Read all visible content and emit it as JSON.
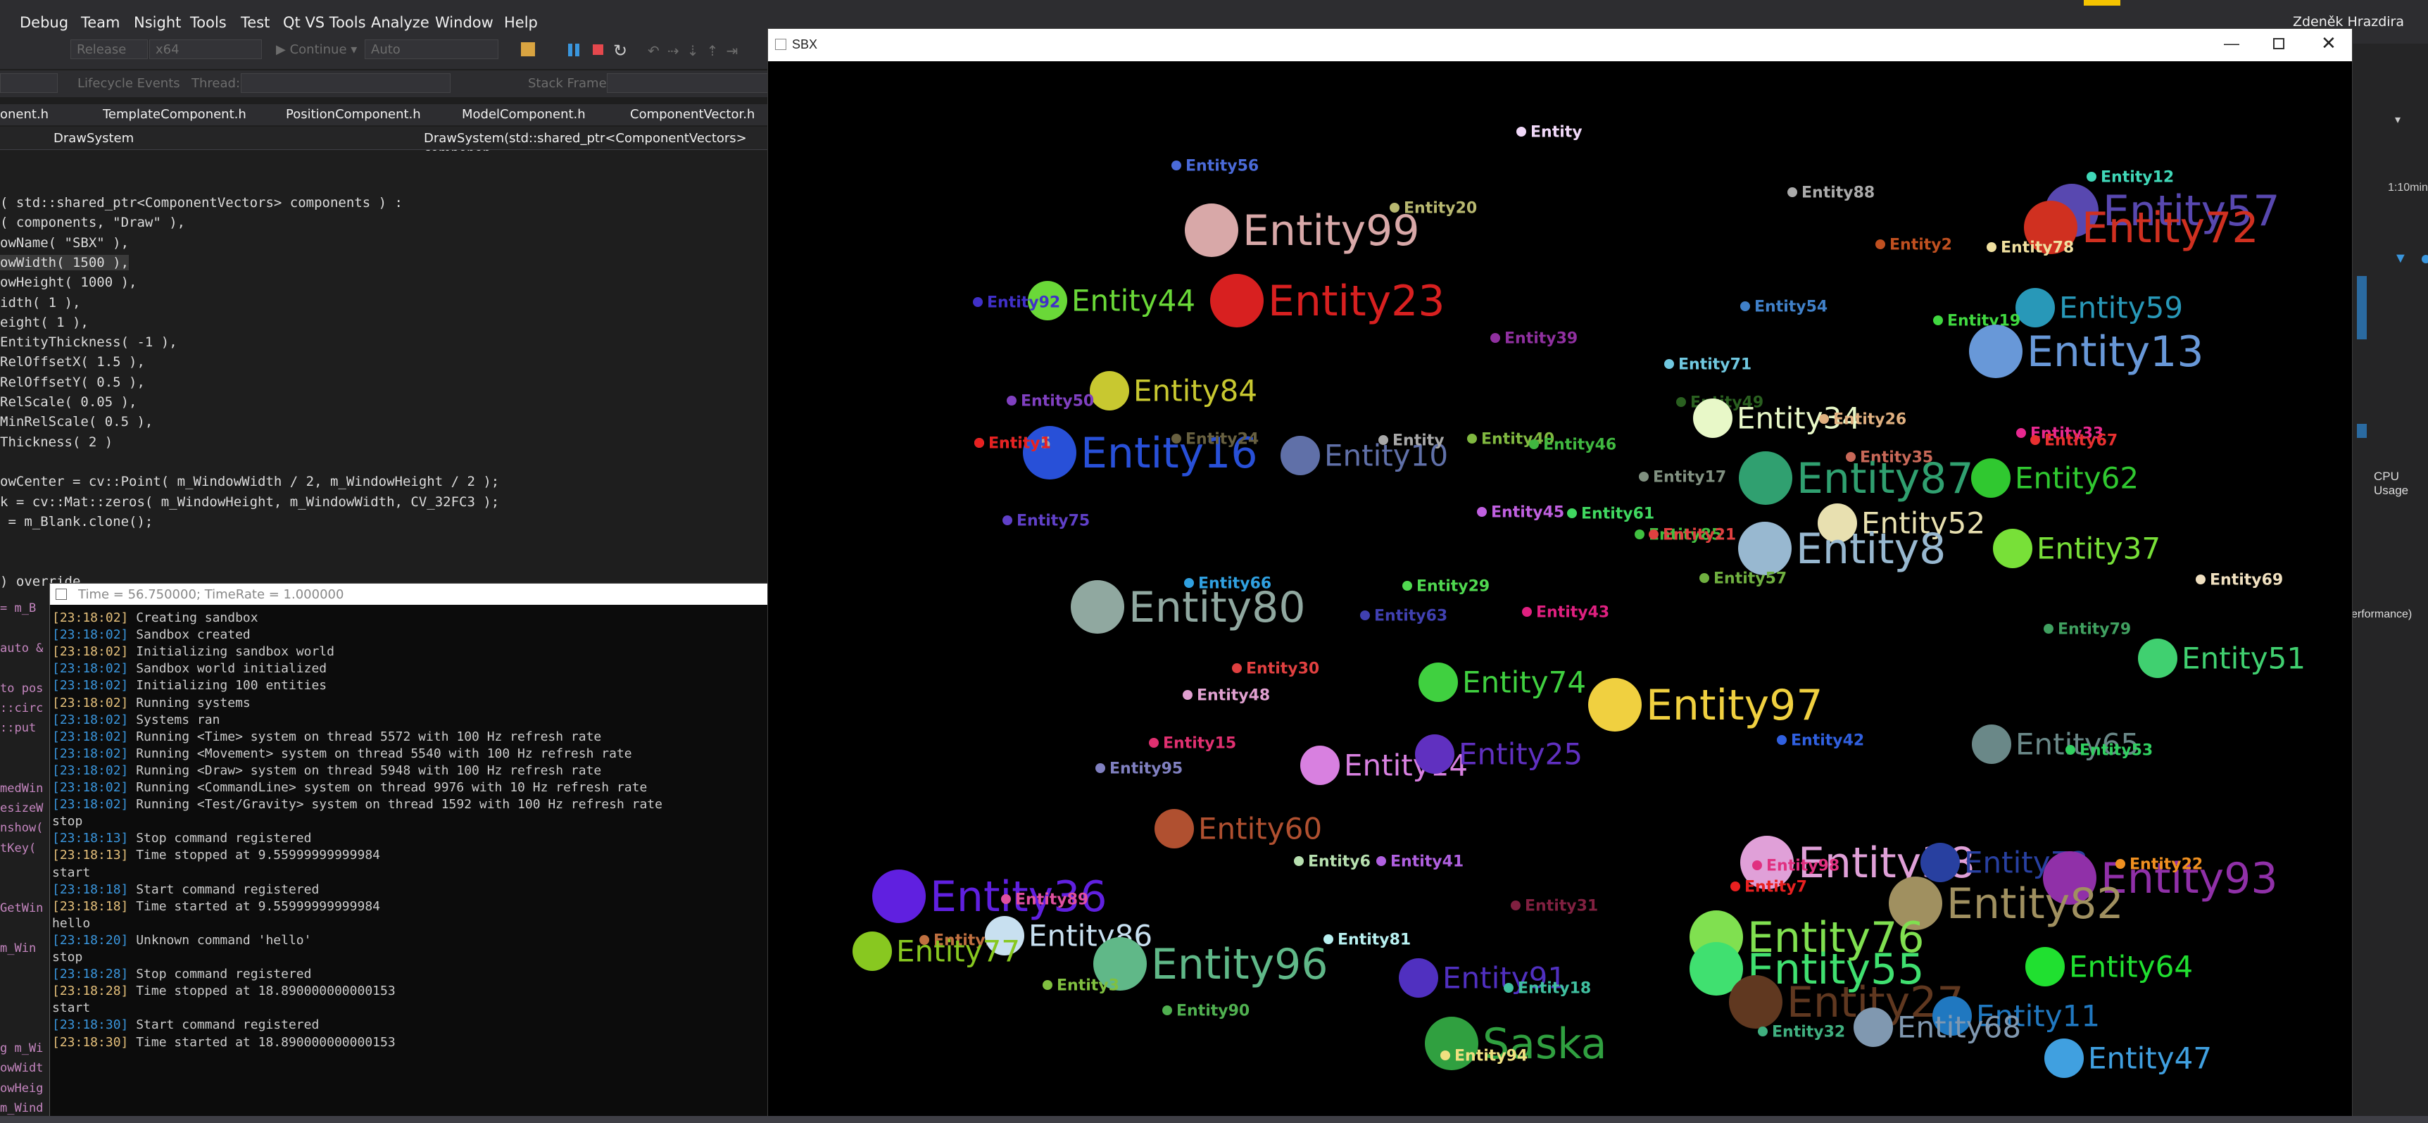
{
  "ide": {
    "menu": [
      "Debug",
      "Team",
      "Nsight",
      "Tools",
      "Test",
      "Qt VS Tools",
      "Analyze",
      "Window",
      "Help"
    ],
    "user": "Zdeněk Hrazdira",
    "toolbar": {
      "config": "Release",
      "platform": "x64",
      "continue_label": "Continue",
      "auto_label": "Auto",
      "lifecycle_label": "Lifecycle Events",
      "thread_label": "Thread:",
      "stack_frame_label": "Stack Frame:"
    },
    "tabs": [
      "onent.h",
      "TemplateComponent.h",
      "PositionComponent.h",
      "ModelComponent.h",
      "ComponentVector.h"
    ],
    "nav_left": "DrawSystem",
    "nav_right": "DrawSystem(std::shared_ptr<ComponentVectors> componen",
    "right_panel": {
      "time_label": "1:10min",
      "cpu_label": "CPU Usage",
      "perf_label": "erformance)"
    }
  },
  "code_lines": [
    "( std::shared_ptr<ComponentVectors> components ) :",
    "( components, \"Draw\" ),",
    "owName( \"SBX\" ),",
    "owWidth( 1500 ),",
    "owHeight( 1000 ),",
    "idth( 1 ),",
    "eight( 1 ),",
    "EntityThickness( -1 ),",
    "RelOffsetX( 1.5 ),",
    "RelOffsetY( 0.5 ),",
    "RelScale( 0.05 ),",
    "MinRelScale( 0.5 ),",
    "Thickness( 2 )",
    "",
    "owCenter = cv::Point( m_WindowWidth / 2, m_WindowHeight / 2 );",
    "k = cv::Mat::zeros( m_WindowHeight, m_WindowWidth, CV_32FC3 );",
    " = m_Blank.clone();",
    "",
    "",
    ") override"
  ],
  "code_left_fragments": [
    "= m_B",
    "",
    "auto &",
    "",
    "to pos",
    "::circ",
    "::put",
    "",
    "",
    "medWin",
    "esizeW",
    "nshow(",
    "tKey(",
    "",
    "",
    "GetWin",
    "",
    "m_Win",
    "",
    "",
    "",
    "",
    "g m_Wi",
    "owWidt",
    "owHeig",
    "m_Wind",
    "m_Wind",
    "owWidt"
  ],
  "console": {
    "title": "Time = 56.750000; TimeRate = 1.000000",
    "lines": [
      {
        "ts": "[23:18:02]",
        "y": true,
        "text": " Creating sandbox"
      },
      {
        "ts": "[23:18:02]",
        "y": false,
        "text": " Sandbox created"
      },
      {
        "ts": "[23:18:02]",
        "y": true,
        "text": " Initializing sandbox world"
      },
      {
        "ts": "[23:18:02]",
        "y": false,
        "text": " Sandbox world initialized"
      },
      {
        "ts": "[23:18:02]",
        "y": false,
        "text": " Initializing 100 entities"
      },
      {
        "ts": "[23:18:02]",
        "y": true,
        "text": " Running systems"
      },
      {
        "ts": "[23:18:02]",
        "y": false,
        "text": " Systems ran"
      },
      {
        "ts": "[23:18:02]",
        "y": false,
        "text": " Running <Time> system on thread 5572 with 100 Hz refresh rate"
      },
      {
        "ts": "[23:18:02]",
        "y": false,
        "text": " Running <Movement> system on thread 5540 with 100 Hz refresh rate"
      },
      {
        "ts": "[23:18:02]",
        "y": false,
        "text": " Running <Draw> system on thread 5948 with 100 Hz refresh rate"
      },
      {
        "ts": "[23:18:02]",
        "y": false,
        "text": " Running <CommandLine> system on thread 9976 with 10 Hz refresh rate"
      },
      {
        "ts": "[23:18:02]",
        "y": false,
        "text": " Running <Test/Gravity> system on thread 1592 with 100 Hz refresh rate"
      },
      {
        "ts": "",
        "y": false,
        "text": "stop"
      },
      {
        "ts": "[23:18:13]",
        "y": false,
        "text": " Stop command registered"
      },
      {
        "ts": "[23:18:13]",
        "y": true,
        "text": " Time stopped at 9.55999999999984"
      },
      {
        "ts": "",
        "y": false,
        "text": "start"
      },
      {
        "ts": "[23:18:18]",
        "y": false,
        "text": " Start command registered"
      },
      {
        "ts": "[23:18:18]",
        "y": true,
        "text": " Time started at 9.55999999999984"
      },
      {
        "ts": "",
        "y": false,
        "text": "hello"
      },
      {
        "ts": "[23:18:20]",
        "y": false,
        "text": " Unknown command 'hello'"
      },
      {
        "ts": "",
        "y": false,
        "text": "stop"
      },
      {
        "ts": "[23:18:28]",
        "y": false,
        "text": " Stop command registered"
      },
      {
        "ts": "[23:18:28]",
        "y": true,
        "text": " Time stopped at 18.890000000000153"
      },
      {
        "ts": "",
        "y": false,
        "text": "start"
      },
      {
        "ts": "[23:18:30]",
        "y": false,
        "text": " Start command registered"
      },
      {
        "ts": "[23:18:30]",
        "y": true,
        "text": " Time started at 18.890000000000153"
      }
    ]
  },
  "sbx": {
    "title": "SBX",
    "entities": [
      {
        "label": "Entity56",
        "color": "#4a6ad8",
        "size": "s"
      },
      {
        "label": "Entity99",
        "color": "#d8a8a8",
        "size": "l"
      },
      {
        "label": "Entity20",
        "color": "#b8b870",
        "size": "s"
      },
      {
        "label": "Entity88",
        "color": "#aaaaaa",
        "size": "s"
      },
      {
        "label": "Entity12",
        "color": "#40d8b8",
        "size": "s"
      },
      {
        "label": "Entity57",
        "color": "#5848b0",
        "size": "l"
      },
      {
        "label": "Entity72",
        "color": "#d03020",
        "size": "l"
      },
      {
        "label": "Entity2",
        "color": "#c05020",
        "size": "s"
      },
      {
        "label": "Entity78",
        "color": "#f0e0a0",
        "size": "s"
      },
      {
        "label": "Entity44",
        "color": "#6ad838",
        "size": "m"
      },
      {
        "label": "Entity23",
        "color": "#d82020",
        "size": "l"
      },
      {
        "label": "Entity54",
        "color": "#4080c8",
        "size": "s"
      },
      {
        "label": "Entity59",
        "color": "#2898b8",
        "size": "m"
      },
      {
        "label": "Entity19",
        "color": "#40d840",
        "size": "s"
      },
      {
        "label": "Entity39",
        "color": "#9030a0",
        "size": "s"
      },
      {
        "label": "Entity13",
        "color": "#6898d8",
        "size": "l"
      },
      {
        "label": "Entity71",
        "color": "#70c8e0",
        "size": "s"
      },
      {
        "label": "Entity84",
        "color": "#c8c830",
        "size": "m"
      },
      {
        "label": "Entity50",
        "color": "#8040c0",
        "size": "s"
      },
      {
        "label": "Entity49",
        "color": "#2a6020",
        "size": "s"
      },
      {
        "label": "Entity34",
        "color": "#e8f8c8",
        "size": "m"
      },
      {
        "label": "Entity26",
        "color": "#e0b080",
        "size": "s"
      },
      {
        "label": "Entity33",
        "color": "#e82890",
        "size": "s"
      },
      {
        "label": "Entity67",
        "color": "#e83030",
        "size": "s"
      },
      {
        "label": "Entity16",
        "color": "#2850d8",
        "size": "l"
      },
      {
        "label": "Entity5",
        "color": "#a8a8a8",
        "size": "s"
      },
      {
        "label": "Entity24",
        "color": "#686040",
        "size": "s"
      },
      {
        "label": "Entity10",
        "color": "#6070a8",
        "size": "m"
      },
      {
        "label": "Entity40",
        "color": "#80b840",
        "size": "s"
      },
      {
        "label": "Entity46",
        "color": "#40b840",
        "size": "s"
      },
      {
        "label": "Entity35",
        "color": "#c86858",
        "size": "s"
      },
      {
        "label": "Entity87",
        "color": "#30a070",
        "size": "l"
      },
      {
        "label": "Entity62",
        "color": "#30c830",
        "size": "m"
      },
      {
        "label": "Entity17",
        "color": "#809080",
        "size": "s"
      },
      {
        "label": "Entity75",
        "color": "#6040c8",
        "size": "s"
      },
      {
        "label": "Entity45",
        "color": "#c060e0",
        "size": "s"
      },
      {
        "label": "Entity61",
        "color": "#40d860",
        "size": "s"
      },
      {
        "label": "Entity85",
        "color": "#40c040",
        "size": "s"
      },
      {
        "label": "Entity21",
        "color": "#e04040",
        "size": "s"
      },
      {
        "label": "Entity52",
        "color": "#e8e0b0",
        "size": "m"
      },
      {
        "label": "Entity8",
        "color": "#98b8d0",
        "size": "l"
      },
      {
        "label": "Entity37",
        "color": "#78e038",
        "size": "m"
      },
      {
        "label": "Entity66",
        "color": "#30a0e0",
        "size": "s"
      },
      {
        "label": "Entity29",
        "color": "#50d850",
        "size": "s"
      },
      {
        "label": "Entity57",
        "color": "#70b040",
        "size": "s"
      },
      {
        "label": "Entity69",
        "color": "#f0e0c0",
        "size": "s"
      },
      {
        "label": "Entity80",
        "color": "#90a8a0",
        "size": "l"
      },
      {
        "label": "Entity63",
        "color": "#4040b0",
        "size": "s"
      },
      {
        "label": "Entity43",
        "color": "#e02080",
        "size": "s"
      },
      {
        "label": "Entity79",
        "color": "#40a060",
        "size": "s"
      },
      {
        "label": "Entity51",
        "color": "#40d070",
        "size": "m"
      },
      {
        "label": "Entity30",
        "color": "#e04040",
        "size": "s"
      },
      {
        "label": "Entity74",
        "color": "#40d040",
        "size": "m"
      },
      {
        "label": "Entity48",
        "color": "#e0a0d0",
        "size": "s"
      },
      {
        "label": "Entity97",
        "color": "#f0d040",
        "size": "l"
      },
      {
        "label": "Entity42",
        "color": "#3060e0",
        "size": "s"
      },
      {
        "label": "Entity65",
        "color": "#6a8888",
        "size": "m"
      },
      {
        "label": "Entity53",
        "color": "#30d060",
        "size": "s"
      },
      {
        "label": "Entity15",
        "color": "#e03070",
        "size": "s"
      },
      {
        "label": "Entity95",
        "color": "#8080c0",
        "size": "s"
      },
      {
        "label": "Entity14",
        "color": "#d880e0",
        "size": "m"
      },
      {
        "label": "Entity25",
        "color": "#6030c0",
        "size": "m"
      },
      {
        "label": "Entity60",
        "color": "#b05030",
        "size": "m"
      },
      {
        "label": "Entity6",
        "color": "#b8e0b0",
        "size": "s"
      },
      {
        "label": "Entity41",
        "color": "#b060e0",
        "size": "s"
      },
      {
        "label": "Entity38",
        "color": "#e0a0d8",
        "size": "l"
      },
      {
        "label": "Entity98",
        "color": "#e03080",
        "size": "s"
      },
      {
        "label": "Entity73",
        "color": "#2840a0",
        "size": "m"
      },
      {
        "label": "Entity93",
        "color": "#9030a8",
        "size": "l"
      },
      {
        "label": "Entity22",
        "color": "#f09020",
        "size": "s"
      },
      {
        "label": "Entity36",
        "color": "#6020e0",
        "size": "l"
      },
      {
        "label": "Entity89",
        "color": "#e050a0",
        "size": "s"
      },
      {
        "label": "Entity31",
        "color": "#802040",
        "size": "s"
      },
      {
        "label": "Entity7",
        "color": "#e82020",
        "size": "s"
      },
      {
        "label": "Entity82",
        "color": "#a09060",
        "size": "l"
      },
      {
        "label": "Entity28",
        "color": "#c07040",
        "size": "s"
      },
      {
        "label": "Entity86",
        "color": "#c8e0f0",
        "size": "m"
      },
      {
        "label": "Entity96",
        "color": "#60b888",
        "size": "l"
      },
      {
        "label": "Entity81",
        "color": "#b8f0f0",
        "size": "s"
      },
      {
        "label": "Entity76",
        "color": "#80e050",
        "size": "l"
      },
      {
        "label": "Entity77",
        "color": "#88c820",
        "size": "m"
      },
      {
        "label": "Entity3",
        "color": "#80c040",
        "size": "s"
      },
      {
        "label": "Entity91",
        "color": "#5030c0",
        "size": "m"
      },
      {
        "label": "Entity18",
        "color": "#40c0a0",
        "size": "s"
      },
      {
        "label": "Entity55",
        "color": "#40e070",
        "size": "l"
      },
      {
        "label": "Entity64",
        "color": "#20e030",
        "size": "m"
      },
      {
        "label": "Entity90",
        "color": "#50b050",
        "size": "s"
      },
      {
        "label": "Entity27",
        "color": "#603820",
        "size": "l"
      },
      {
        "label": "Entity11",
        "color": "#2078c0",
        "size": "m"
      },
      {
        "label": "Entity32",
        "color": "#40b080",
        "size": "s"
      },
      {
        "label": "Entity68",
        "color": "#8098b0",
        "size": "m"
      },
      {
        "label": "Entity47",
        "color": "#40a0e0",
        "size": "m"
      },
      {
        "label": "Saska",
        "color": "#30a040",
        "size": "l"
      },
      {
        "label": "Entity94",
        "color": "#f0e080",
        "size": "s"
      },
      {
        "label": "Entity92",
        "color": "#4030c8",
        "size": "s"
      },
      {
        "label": "Entity1",
        "color": "#e82020",
        "size": "s"
      },
      {
        "label": "Entity",
        "color": "#a8a8a8",
        "size": "s"
      },
      {
        "label": "Entity",
        "color": "#f0d8f8",
        "size": "s"
      }
    ]
  }
}
